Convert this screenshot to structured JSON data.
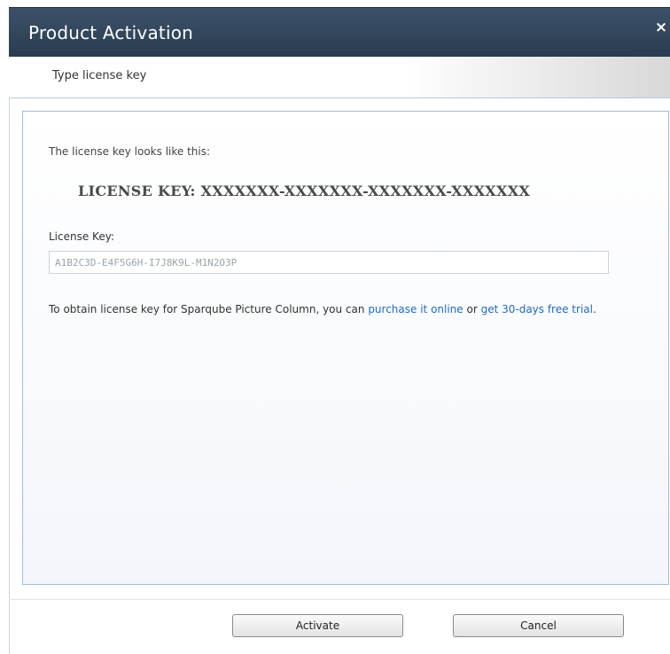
{
  "window": {
    "title": "Product Activation",
    "close_glyph": "×"
  },
  "step": {
    "label": "Type license key"
  },
  "content": {
    "hint": "The license key looks like this:",
    "example_key": "LICENSE KEY: XXXXXXX-XXXXXXX-XXXXXXX-XXXXXXX",
    "field_label": "License Key:",
    "field_value": "A1B2C3D-E4F5G6H-I7J8K9L-M1N2O3P",
    "info_prefix": "To obtain license key for Sparqube Picture Column, you can ",
    "purchase_link": "purchase it online",
    "info_middle": " or ",
    "trial_link": "get 30-days free trial",
    "info_suffix": "."
  },
  "buttons": {
    "activate": "Activate",
    "cancel": "Cancel"
  },
  "colors": {
    "titlebar": "#2e4157",
    "link": "#1f6bc4",
    "panel_border": "#a8bcd4"
  }
}
